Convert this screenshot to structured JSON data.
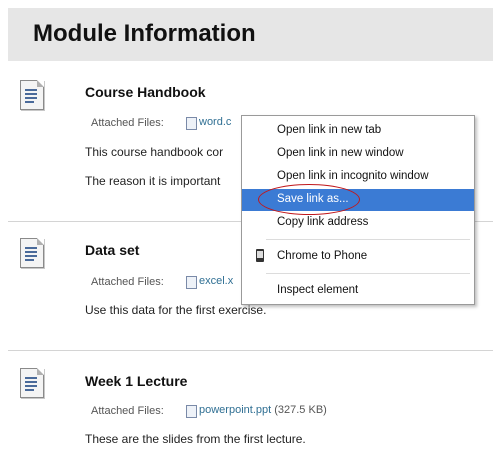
{
  "header": {
    "title": "Module Information"
  },
  "items": [
    {
      "title": "Course Handbook",
      "attached_label": "Attached Files:",
      "file_name": "word.docx",
      "file_visible": "word.c",
      "file_size": "",
      "desc1": "This course handbook cor",
      "desc2": "The reason it is important"
    },
    {
      "title": "Data set",
      "attached_label": "Attached Files:",
      "file_visible": "excel.x",
      "file_size": "",
      "desc1": "Use this data for the first exercise."
    },
    {
      "title": "Week 1 Lecture",
      "attached_label": "Attached Files:",
      "file_visible": "powerpoint.ppt",
      "file_size": "(327.5 KB)",
      "desc1": "These are the slides from the first lecture."
    }
  ],
  "context_menu": {
    "items": [
      {
        "label": "Open link in new tab"
      },
      {
        "label": "Open link in new window"
      },
      {
        "label": "Open link in incognito window"
      },
      {
        "label": "Save link as...",
        "active": true
      },
      {
        "label": "Copy link address"
      },
      {
        "label": "Chrome to Phone",
        "icon": "phone-icon"
      },
      {
        "label": "Inspect element"
      }
    ]
  },
  "colors": {
    "menu_active": "#3b7bd4",
    "link": "#2f6f93",
    "highlight_ring": "#c0181c"
  }
}
